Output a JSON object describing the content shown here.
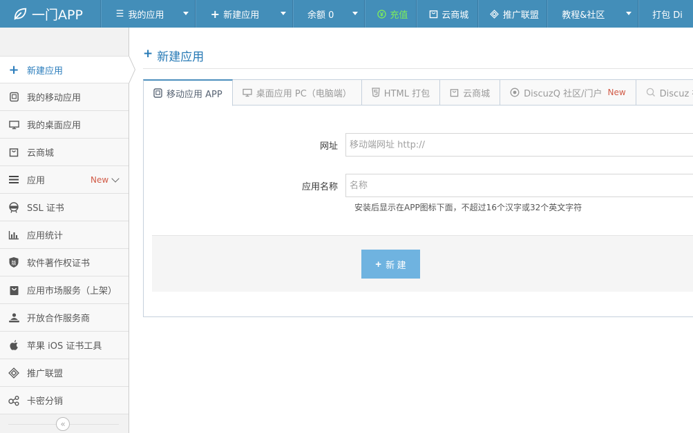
{
  "brand": {
    "name": "一门APP"
  },
  "topnav": [
    {
      "label": "我的应用",
      "icon": "list-icon"
    },
    {
      "label": "新建应用",
      "icon": "plus-icon"
    },
    {
      "label": "余额 0",
      "icon": ""
    },
    {
      "label": "充值",
      "icon": "yen-icon"
    },
    {
      "label": "云商城",
      "icon": "shop-icon"
    },
    {
      "label": "推广联盟",
      "icon": "diamond-icon"
    },
    {
      "label": "教程&社区",
      "icon": ""
    },
    {
      "label": "打包 Di",
      "icon": ""
    }
  ],
  "sidebar": {
    "items": [
      {
        "label": "新建应用",
        "icon": "plus-icon"
      },
      {
        "label": "我的移动应用",
        "icon": "tablet-icon"
      },
      {
        "label": "我的桌面应用",
        "icon": "desktop-icon"
      },
      {
        "label": "云商城",
        "icon": "shop-icon"
      },
      {
        "label": "应用",
        "icon": "bars-icon",
        "badge": "New"
      },
      {
        "label": "SSL 证书",
        "icon": "ssl-icon"
      },
      {
        "label": "应用统计",
        "icon": "bar-chart-icon"
      },
      {
        "label": "软件著作权证书",
        "icon": "copyright-shield-icon"
      },
      {
        "label": "应用市场服务（上架）",
        "icon": "store-icon"
      },
      {
        "label": "开放合作服务商",
        "icon": "service-icon"
      },
      {
        "label": "苹果 iOS 证书工具",
        "icon": "apple-icon"
      },
      {
        "label": "推广联盟",
        "icon": "diamond-icon"
      },
      {
        "label": "卡密分销",
        "icon": "share-icon"
      }
    ],
    "collapse_glyph": "«"
  },
  "page": {
    "title": "新建应用"
  },
  "tabs": [
    {
      "label": "移动应用 APP",
      "icon": "tablet-icon"
    },
    {
      "label": "桌面应用 PC（电脑端）",
      "icon": "desktop-icon"
    },
    {
      "label": "HTML 打包",
      "icon": "html5-icon"
    },
    {
      "label": "云商城",
      "icon": "shop-icon"
    },
    {
      "label": "DiscuzQ 社区/门户",
      "icon": "discuz-icon",
      "badge": "New"
    },
    {
      "label": "Discuz 社",
      "icon": "discuz-icon"
    }
  ],
  "form": {
    "url": {
      "label": "网址",
      "placeholder": "移动端网址 http://"
    },
    "name": {
      "label": "应用名称",
      "placeholder": "名称",
      "help": "安装后显示在APP图标下面，不超过16个汉字或32个英文字符"
    },
    "submit_label": "新 建"
  }
}
